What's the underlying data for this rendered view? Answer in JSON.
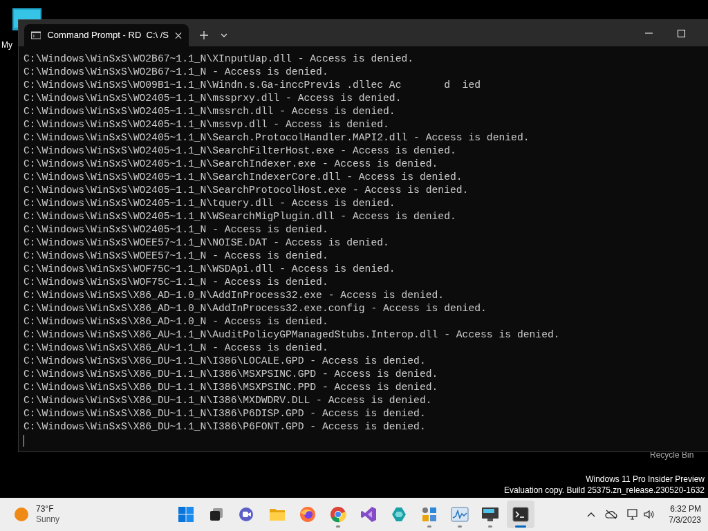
{
  "desktop_icons": [
    {
      "label": "My",
      "kind": "computer"
    },
    {
      "label": "Recycle Bin"
    }
  ],
  "window": {
    "tab_title": "Command Prompt - RD  C:\\ /S",
    "lines": [
      "C:\\Windows\\WinSxS\\WO2B67~1.1_N\\XInputUap.dll - Access is denied.",
      "C:\\Windows\\WinSxS\\WO2B67~1.1_N - Access is denied.",
      "C:\\Windows\\WinSxS\\WO09B1~1.1_N\\Windn.s.Ga-inccPrevis .dllec Ac       d  ied",
      "C:\\Windows\\WinSxS\\WO2405~1.1_N\\mssprxy.dll - Access is denied.",
      "C:\\Windows\\WinSxS\\WO2405~1.1_N\\mssrch.dll - Access is denied.",
      "C:\\Windows\\WinSxS\\WO2405~1.1_N\\mssvp.dll - Access is denied.",
      "C:\\Windows\\WinSxS\\WO2405~1.1_N\\Search.ProtocolHandler.MAPI2.dll - Access is denied.",
      "C:\\Windows\\WinSxS\\WO2405~1.1_N\\SearchFilterHost.exe - Access is denied.",
      "C:\\Windows\\WinSxS\\WO2405~1.1_N\\SearchIndexer.exe - Access is denied.",
      "C:\\Windows\\WinSxS\\WO2405~1.1_N\\SearchIndexerCore.dll - Access is denied.",
      "C:\\Windows\\WinSxS\\WO2405~1.1_N\\SearchProtocolHost.exe - Access is denied.",
      "C:\\Windows\\WinSxS\\WO2405~1.1_N\\tquery.dll - Access is denied.",
      "C:\\Windows\\WinSxS\\WO2405~1.1_N\\WSearchMigPlugin.dll - Access is denied.",
      "C:\\Windows\\WinSxS\\WO2405~1.1_N - Access is denied.",
      "C:\\Windows\\WinSxS\\WOEE57~1.1_N\\NOISE.DAT - Access is denied.",
      "C:\\Windows\\WinSxS\\WOEE57~1.1_N - Access is denied.",
      "C:\\Windows\\WinSxS\\WOF75C~1.1_N\\WSDApi.dll - Access is denied.",
      "C:\\Windows\\WinSxS\\WOF75C~1.1_N - Access is denied.",
      "C:\\Windows\\WinSxS\\X86_AD~1.0_N\\AddInProcess32.exe - Access is denied.",
      "C:\\Windows\\WinSxS\\X86_AD~1.0_N\\AddInProcess32.exe.config - Access is denied.",
      "C:\\Windows\\WinSxS\\X86_AD~1.0_N - Access is denied.",
      "C:\\Windows\\WinSxS\\X86_AU~1.1_N\\AuditPolicyGPManagedStubs.Interop.dll - Access is denied.",
      "C:\\Windows\\WinSxS\\X86_AU~1.1_N - Access is denied.",
      "C:\\Windows\\WinSxS\\X86_DU~1.1_N\\I386\\LOCALE.GPD - Access is denied.",
      "C:\\Windows\\WinSxS\\X86_DU~1.1_N\\I386\\MSXPSINC.GPD - Access is denied.",
      "C:\\Windows\\WinSxS\\X86_DU~1.1_N\\I386\\MSXPSINC.PPD - Access is denied.",
      "C:\\Windows\\WinSxS\\X86_DU~1.1_N\\I386\\MXDWDRV.DLL - Access is denied.",
      "C:\\Windows\\WinSxS\\X86_DU~1.1_N\\I386\\P6DISP.GPD - Access is denied.",
      "C:\\Windows\\WinSxS\\X86_DU~1.1_N\\I386\\P6FONT.GPD - Access is denied."
    ]
  },
  "watermark": [
    "Windows 11 Pro Insider Preview",
    "Evaluation copy. Build 25375.zn_release.230520-1632"
  ],
  "taskbar": {
    "weather": {
      "temperature": "73°F",
      "condition": "Sunny"
    },
    "apps": [
      {
        "kind": "start",
        "running": false,
        "selected": false
      },
      {
        "kind": "taskview",
        "running": false,
        "selected": false
      },
      {
        "kind": "chat",
        "running": false,
        "selected": false
      },
      {
        "kind": "folder",
        "running": false,
        "selected": false
      },
      {
        "kind": "firefox",
        "running": false,
        "selected": false
      },
      {
        "kind": "chrome",
        "running": true,
        "selected": false
      },
      {
        "kind": "vs",
        "running": false,
        "selected": false
      },
      {
        "kind": "azure",
        "running": false,
        "selected": false
      },
      {
        "kind": "apps",
        "running": true,
        "selected": false
      },
      {
        "kind": "monitor",
        "running": true,
        "selected": false
      },
      {
        "kind": "remote",
        "running": true,
        "selected": false
      },
      {
        "kind": "terminal",
        "running": true,
        "selected": true
      }
    ],
    "clock": {
      "time": "6:32 PM",
      "date": "7/3/2023"
    }
  }
}
